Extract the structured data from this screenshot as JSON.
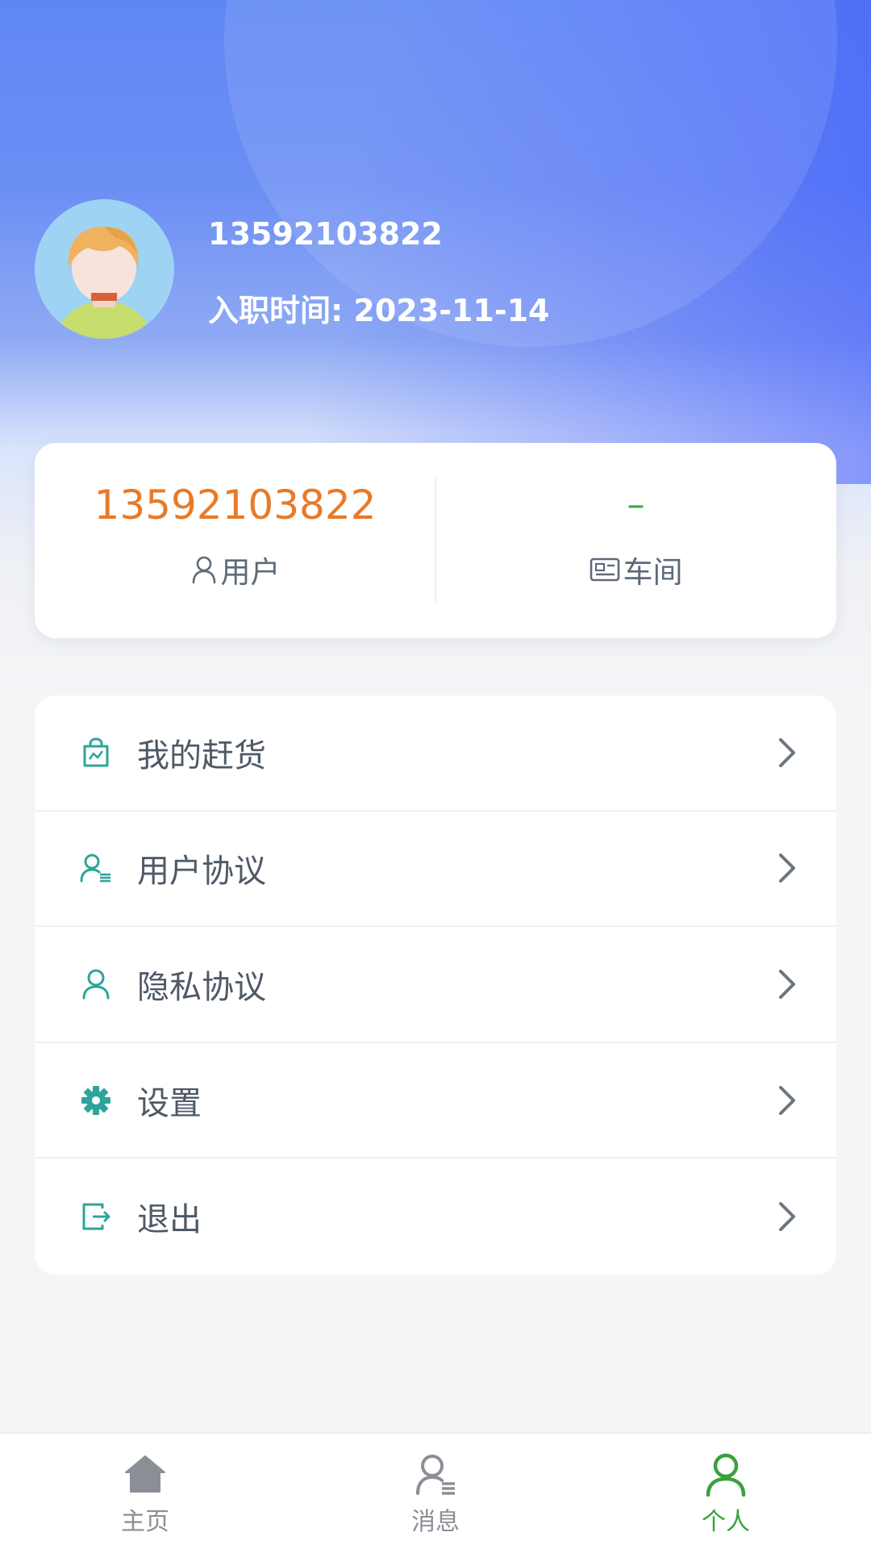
{
  "profile": {
    "name": "13592103822",
    "join_date": "入职时间: 2023-11-14"
  },
  "stats": {
    "user_value": "13592103822",
    "user_label": "用户",
    "dept_value": "–",
    "dept_label": "车间"
  },
  "menu": {
    "items": [
      {
        "label": "我的赶货",
        "icon": "shopping-bag-icon"
      },
      {
        "label": "用户协议",
        "icon": "user-list-icon"
      },
      {
        "label": "隐私协议",
        "icon": "user-icon"
      },
      {
        "label": "设置",
        "icon": "gear-icon"
      },
      {
        "label": "退出",
        "icon": "logout-icon"
      }
    ]
  },
  "tabbar": {
    "items": [
      {
        "label": "主页",
        "icon": "home-icon"
      },
      {
        "label": "消息",
        "icon": "message-user-icon"
      },
      {
        "label": "个人",
        "icon": "person-icon",
        "active": true
      }
    ]
  },
  "colors": {
    "accent_teal": "#2ea59a",
    "user_value": "#e87a27",
    "dept_value": "#3aab3d",
    "tab_active": "#3aa13c"
  }
}
